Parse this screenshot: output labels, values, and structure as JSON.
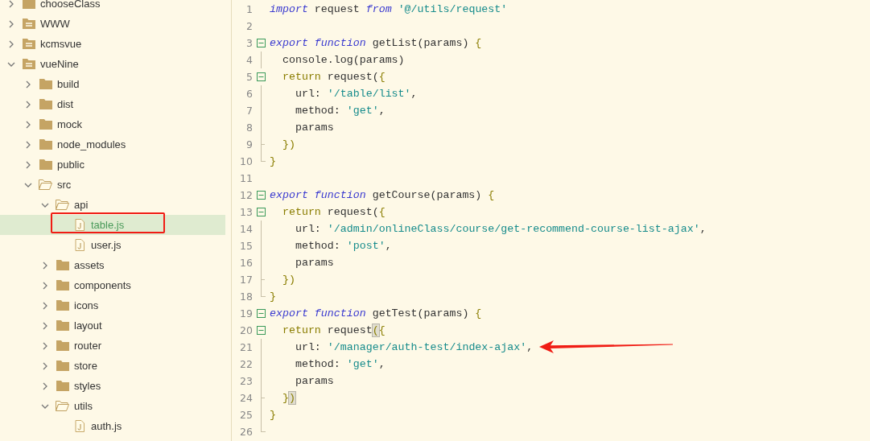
{
  "sidebar": {
    "tree": [
      {
        "label": "chooseClass",
        "kind": "folder",
        "expanded": false,
        "selected": false,
        "highlighted": false
      },
      {
        "label": "WWW",
        "kind": "project",
        "expanded": false,
        "selected": false,
        "highlighted": false
      },
      {
        "label": "kcmsvue",
        "kind": "project",
        "expanded": false,
        "selected": false,
        "highlighted": false
      },
      {
        "label": "vueNine",
        "kind": "project",
        "expanded": true,
        "selected": false,
        "highlighted": false,
        "children": [
          {
            "label": "build",
            "kind": "folder",
            "expanded": false,
            "selected": false,
            "highlighted": false
          },
          {
            "label": "dist",
            "kind": "folder",
            "expanded": false,
            "selected": false,
            "highlighted": false
          },
          {
            "label": "mock",
            "kind": "folder",
            "expanded": false,
            "selected": false,
            "highlighted": false
          },
          {
            "label": "node_modules",
            "kind": "folder",
            "expanded": false,
            "selected": false,
            "highlighted": false
          },
          {
            "label": "public",
            "kind": "folder",
            "expanded": false,
            "selected": false,
            "highlighted": false
          },
          {
            "label": "src",
            "kind": "folder",
            "expanded": true,
            "selected": false,
            "highlighted": false,
            "children": [
              {
                "label": "api",
                "kind": "folder",
                "expanded": true,
                "selected": false,
                "highlighted": false,
                "children": [
                  {
                    "label": "table.js",
                    "kind": "file",
                    "selected": true,
                    "highlighted": true
                  },
                  {
                    "label": "user.js",
                    "kind": "file",
                    "selected": false,
                    "highlighted": false
                  }
                ]
              },
              {
                "label": "assets",
                "kind": "folder",
                "expanded": false,
                "selected": false,
                "highlighted": false
              },
              {
                "label": "components",
                "kind": "folder",
                "expanded": false,
                "selected": false,
                "highlighted": false
              },
              {
                "label": "icons",
                "kind": "folder",
                "expanded": false,
                "selected": false,
                "highlighted": false
              },
              {
                "label": "layout",
                "kind": "folder",
                "expanded": false,
                "selected": false,
                "highlighted": false
              },
              {
                "label": "router",
                "kind": "folder",
                "expanded": false,
                "selected": false,
                "highlighted": false
              },
              {
                "label": "store",
                "kind": "folder",
                "expanded": false,
                "selected": false,
                "highlighted": false
              },
              {
                "label": "styles",
                "kind": "folder",
                "expanded": false,
                "selected": false,
                "highlighted": false
              },
              {
                "label": "utils",
                "kind": "folder",
                "expanded": true,
                "selected": false,
                "highlighted": false,
                "children": [
                  {
                    "label": "auth.js",
                    "kind": "file",
                    "selected": false,
                    "highlighted": false
                  }
                ]
              }
            ]
          }
        ]
      }
    ]
  },
  "editor": {
    "lines": [
      {
        "number": "1",
        "kind": "plain",
        "tokens": [
          {
            "kind": "keyword",
            "text": "import"
          },
          {
            "kind": "plain",
            "text": " request "
          },
          {
            "kind": "keyword",
            "text": "from "
          },
          {
            "kind": "string",
            "text": "'@/utils/request'"
          }
        ]
      },
      {
        "number": "2",
        "kind": "plain"
      },
      {
        "number": "3",
        "kind": "fold-start",
        "tokens": [
          {
            "kind": "keyword",
            "text": "export "
          },
          {
            "kind": "keyword",
            "text": "function"
          },
          {
            "kind": "plain",
            "text": " getList(params) "
          },
          {
            "kind": "bracket",
            "text": "{"
          }
        ]
      },
      {
        "number": "4",
        "kind": "fold-inside",
        "tokens": [
          {
            "kind": "plain",
            "text": "  console.log(params)"
          }
        ]
      },
      {
        "number": "5",
        "kind": "fold-start",
        "tokens": [
          {
            "kind": "bracket",
            "text": "  return"
          },
          {
            "kind": "plain",
            "text": " request("
          },
          {
            "kind": "bracket",
            "text": "{"
          }
        ]
      },
      {
        "number": "6",
        "kind": "fold-inside",
        "tokens": [
          {
            "kind": "plain",
            "text": "    url: "
          },
          {
            "kind": "string",
            "text": "'/table/list'"
          },
          {
            "kind": "plain",
            "text": ","
          }
        ]
      },
      {
        "number": "7",
        "kind": "fold-inside",
        "tokens": [
          {
            "kind": "plain",
            "text": "    method: "
          },
          {
            "kind": "string",
            "text": "'get'"
          },
          {
            "kind": "plain",
            "text": ","
          }
        ]
      },
      {
        "number": "8",
        "kind": "fold-inside",
        "tokens": [
          {
            "kind": "plain",
            "text": "    params"
          }
        ]
      },
      {
        "number": "9",
        "kind": "fold-branch",
        "tokens": [
          {
            "kind": "bracket",
            "text": "  })"
          }
        ]
      },
      {
        "number": "10",
        "kind": "fold-end",
        "tokens": [
          {
            "kind": "bracket",
            "text": "}"
          }
        ]
      },
      {
        "number": "11",
        "kind": "plain"
      },
      {
        "number": "12",
        "kind": "fold-start",
        "tokens": [
          {
            "kind": "keyword",
            "text": "export "
          },
          {
            "kind": "keyword",
            "text": "function"
          },
          {
            "kind": "plain",
            "text": " getCourse(params) "
          },
          {
            "kind": "bracket",
            "text": "{"
          }
        ]
      },
      {
        "number": "13",
        "kind": "fold-start",
        "tokens": [
          {
            "kind": "bracket",
            "text": "  return"
          },
          {
            "kind": "plain",
            "text": " request("
          },
          {
            "kind": "bracket",
            "text": "{"
          }
        ]
      },
      {
        "number": "14",
        "kind": "fold-inside",
        "tokens": [
          {
            "kind": "plain",
            "text": "    url: "
          },
          {
            "kind": "string",
            "text": "'/admin/onlineClass/course/get-recommend-course-list-ajax'"
          },
          {
            "kind": "plain",
            "text": ","
          }
        ]
      },
      {
        "number": "15",
        "kind": "fold-inside",
        "tokens": [
          {
            "kind": "plain",
            "text": "    method: "
          },
          {
            "kind": "string",
            "text": "'post'"
          },
          {
            "kind": "plain",
            "text": ","
          }
        ]
      },
      {
        "number": "16",
        "kind": "fold-inside",
        "tokens": [
          {
            "kind": "plain",
            "text": "    params"
          }
        ]
      },
      {
        "number": "17",
        "kind": "fold-branch",
        "tokens": [
          {
            "kind": "bracket",
            "text": "  })"
          }
        ]
      },
      {
        "number": "18",
        "kind": "fold-end",
        "tokens": [
          {
            "kind": "bracket",
            "text": "}"
          }
        ]
      },
      {
        "number": "19",
        "kind": "fold-start",
        "tokens": [
          {
            "kind": "keyword",
            "text": "export "
          },
          {
            "kind": "keyword",
            "text": "function"
          },
          {
            "kind": "plain",
            "text": " getTest(params) "
          },
          {
            "kind": "bracket",
            "text": "{"
          }
        ]
      },
      {
        "number": "20",
        "kind": "fold-start",
        "tokens": [
          {
            "kind": "bracket",
            "text": "  return"
          },
          {
            "kind": "plain",
            "text": " request"
          },
          {
            "kind": "match",
            "text": "("
          },
          {
            "kind": "bracket",
            "text": "{"
          }
        ]
      },
      {
        "number": "21",
        "kind": "fold-inside",
        "arrow": true,
        "tokens": [
          {
            "kind": "plain",
            "text": "    url: "
          },
          {
            "kind": "string",
            "text": "'/manager/auth-test/index-ajax'"
          },
          {
            "kind": "plain",
            "text": ","
          }
        ]
      },
      {
        "number": "22",
        "kind": "fold-inside",
        "tokens": [
          {
            "kind": "plain",
            "text": "    method: "
          },
          {
            "kind": "string",
            "text": "'get'"
          },
          {
            "kind": "plain",
            "text": ","
          }
        ]
      },
      {
        "number": "23",
        "kind": "fold-inside",
        "tokens": [
          {
            "kind": "plain",
            "text": "    params"
          }
        ]
      },
      {
        "number": "24",
        "kind": "fold-branch",
        "tokens": [
          {
            "kind": "bracket",
            "text": "  }"
          },
          {
            "kind": "match",
            "text": ")"
          }
        ]
      },
      {
        "number": "25",
        "kind": "fold-inside",
        "tokens": [
          {
            "kind": "bracket",
            "text": "}"
          }
        ]
      },
      {
        "number": "26",
        "kind": "fold-end"
      }
    ]
  }
}
